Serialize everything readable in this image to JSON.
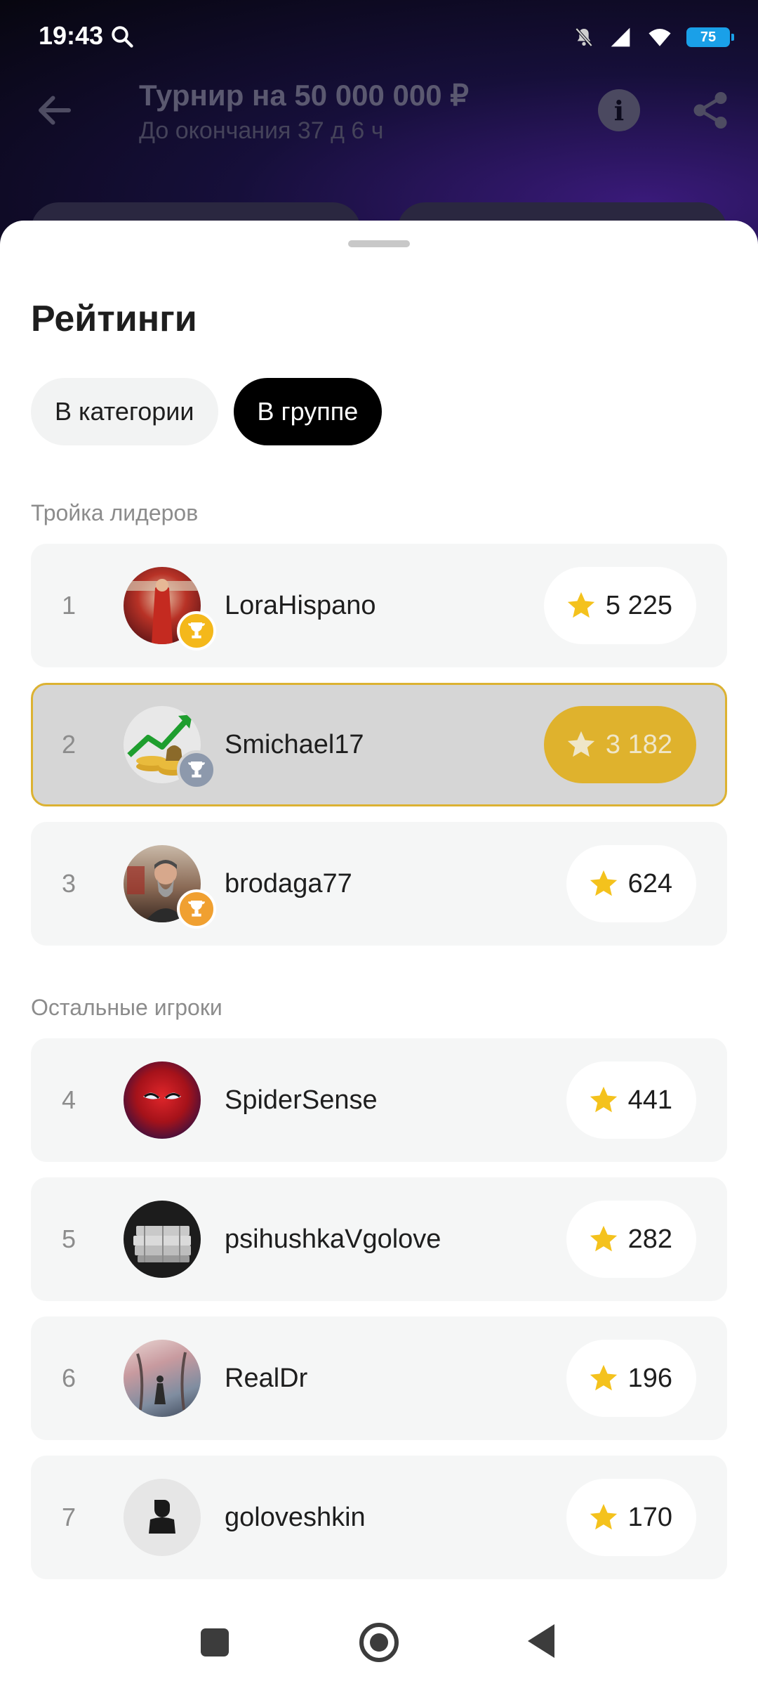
{
  "status_bar": {
    "time": "19:43",
    "battery": "75"
  },
  "header": {
    "title": "Турнир на 50 000 000 ₽",
    "subtitle": "До окончания 37 д 6 ч",
    "back_icon": "arrow-left-icon",
    "info_icon": "info-icon",
    "share_icon": "share-icon"
  },
  "sheet": {
    "title": "Рейтинги",
    "tabs": [
      {
        "label": "В категории",
        "active": false
      },
      {
        "label": "В группе",
        "active": true
      }
    ],
    "leaders_label": "Тройка лидеров",
    "others_label": "Остальные игроки",
    "leaders": [
      {
        "rank": "1",
        "name": "LoraHispano",
        "score": "5 225",
        "badge": "gold-trophy-icon"
      },
      {
        "rank": "2",
        "name": "Smichael17",
        "score": "3 182",
        "badge": "silver-trophy-icon",
        "current_user": true
      },
      {
        "rank": "3",
        "name": "brodaga77",
        "score": "624",
        "badge": "bronze-trophy-icon"
      }
    ],
    "others": [
      {
        "rank": "4",
        "name": "SpiderSense",
        "score": "441"
      },
      {
        "rank": "5",
        "name": "psihushkaVgolove",
        "score": "282"
      },
      {
        "rank": "6",
        "name": "RealDr",
        "score": "196"
      },
      {
        "rank": "7",
        "name": "goloveshkin",
        "score": "170"
      }
    ]
  },
  "colors": {
    "accent_yellow": "#dfb22d",
    "star": "#f4c21d",
    "highlight_border": "#dcb232"
  }
}
